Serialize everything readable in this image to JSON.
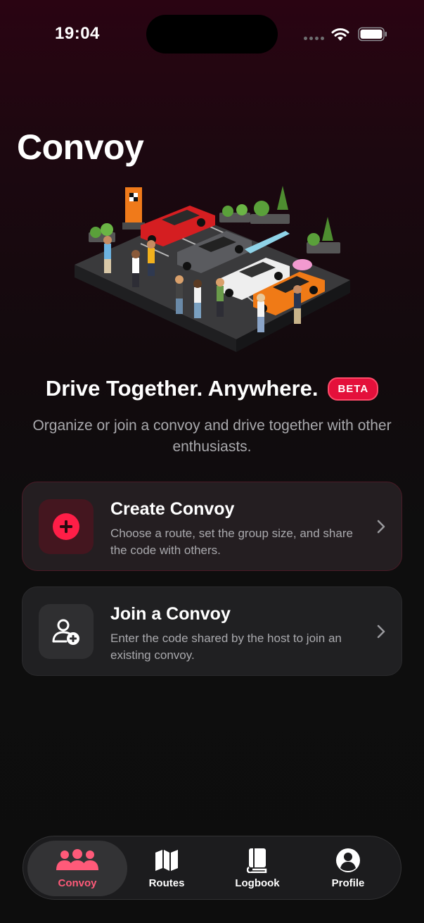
{
  "status_bar": {
    "time": "19:04"
  },
  "header": {
    "title": "Convoy"
  },
  "hero": {
    "tagline": "Drive Together. Anywhere.",
    "badge": "BETA",
    "subtitle": "Organize or join a convoy and drive together with other enthusiasts."
  },
  "actions": [
    {
      "title": "Create Convoy",
      "description": "Choose a route, set the group size, and share the code with others.",
      "icon": "plus-circle-icon"
    },
    {
      "title": "Join a Convoy",
      "description": "Enter the code shared by the host to join an existing convoy.",
      "icon": "person-add-icon"
    }
  ],
  "tab_bar": {
    "active": "Convoy",
    "tabs": [
      {
        "label": "Convoy",
        "icon": "group-icon"
      },
      {
        "label": "Routes",
        "icon": "map-icon"
      },
      {
        "label": "Logbook",
        "icon": "book-icon"
      },
      {
        "label": "Profile",
        "icon": "person-circle-icon"
      }
    ]
  },
  "colors": {
    "accent": "#ff3b5f",
    "beta_badge": "#e4103b",
    "background": "#0d0d0d"
  }
}
